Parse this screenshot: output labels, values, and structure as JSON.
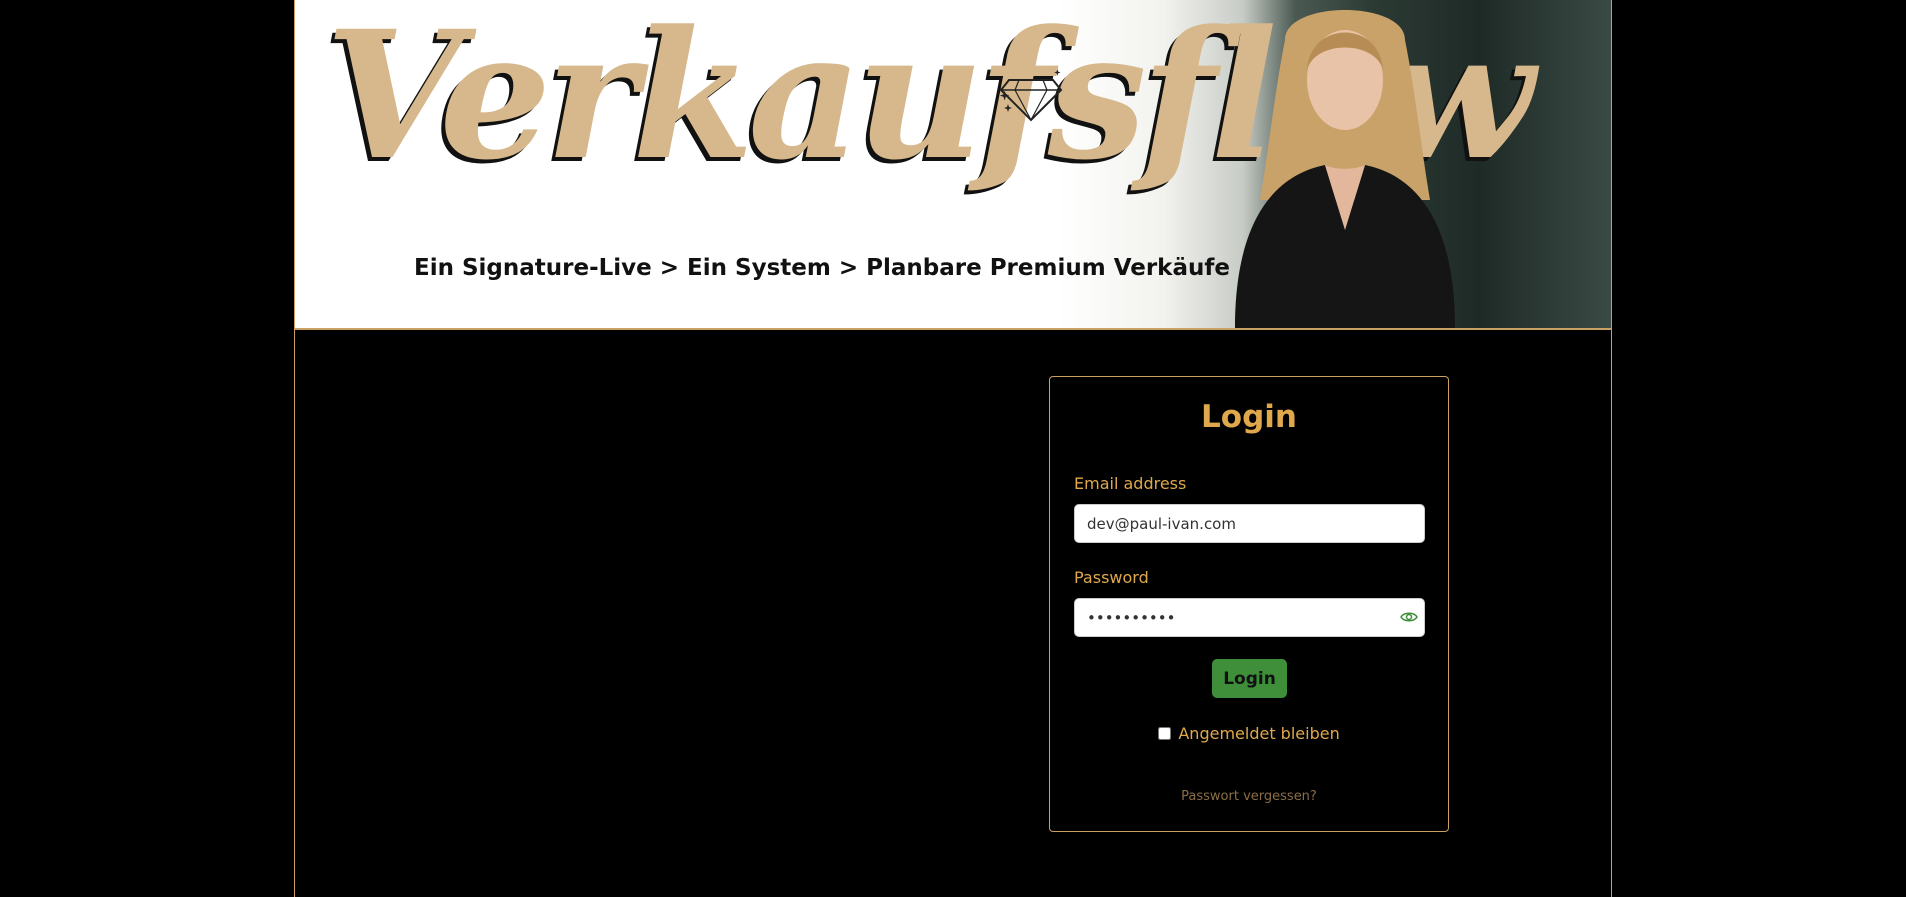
{
  "banner": {
    "title": "Verkaufsflow",
    "tagline": "Ein Signature-Live > Ein System > Planbare Premium Verkäufe",
    "icon": "diamond-icon"
  },
  "login": {
    "title": "Login",
    "email_label": "Email address",
    "email_value": "dev@paul-ivan.com",
    "password_label": "Password",
    "password_value": "••••••••••",
    "password_toggle_icon": "eye-icon",
    "submit_label": "Login",
    "remember_label": "Angemeldet bleiben",
    "remember_checked": false,
    "forgot_label": "Passwort vergessen?"
  },
  "colors": {
    "accent": "#e0a84c",
    "border": "#c9a063",
    "button": "#3f8f3a",
    "background": "#000000"
  }
}
